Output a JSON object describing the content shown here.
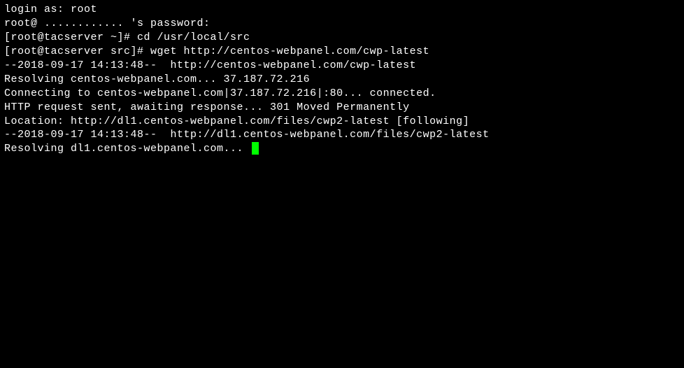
{
  "terminal": {
    "lines": [
      "login as: root",
      "root@ ............ 's password:",
      "[root@tacserver ~]# cd /usr/local/src",
      "[root@tacserver src]# wget http://centos-webpanel.com/cwp-latest",
      "--2018-09-17 14:13:48--  http://centos-webpanel.com/cwp-latest",
      "Resolving centos-webpanel.com... 37.187.72.216",
      "Connecting to centos-webpanel.com|37.187.72.216|:80... connected.",
      "HTTP request sent, awaiting response... 301 Moved Permanently",
      "Location: http://dl1.centos-webpanel.com/files/cwp2-latest [following]",
      "--2018-09-17 14:13:48--  http://dl1.centos-webpanel.com/files/cwp2-latest",
      "Resolving dl1.centos-webpanel.com... "
    ]
  }
}
